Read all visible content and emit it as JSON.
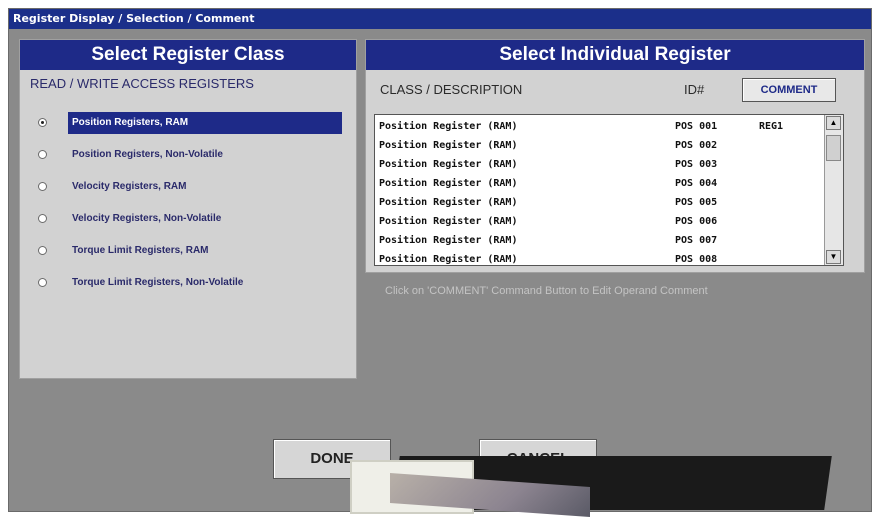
{
  "window": {
    "title": "Register Display / Selection / Comment"
  },
  "left_panel": {
    "header": "Select Register Class",
    "subtitle": "READ / WRITE ACCESS REGISTERS",
    "options": [
      {
        "label": "Position Registers, RAM",
        "checked": true
      },
      {
        "label": "Position Registers, Non-Volatile",
        "checked": false
      },
      {
        "label": "Velocity Registers, RAM",
        "checked": false
      },
      {
        "label": "Velocity Registers, Non-Volatile",
        "checked": false
      },
      {
        "label": "Torque Limit Registers, RAM",
        "checked": false
      },
      {
        "label": "Torque Limit Registers, Non-Volatile",
        "checked": false
      }
    ]
  },
  "right_panel": {
    "header": "Select Individual Register",
    "col_class": "CLASS / DESCRIPTION",
    "col_id": "ID#",
    "comment_button": "COMMENT",
    "rows": [
      {
        "description": "Position Register (RAM)",
        "id": "POS 001",
        "comment": "REG1"
      },
      {
        "description": "Position Register (RAM)",
        "id": "POS 002",
        "comment": ""
      },
      {
        "description": "Position Register (RAM)",
        "id": "POS 003",
        "comment": ""
      },
      {
        "description": "Position Register (RAM)",
        "id": "POS 004",
        "comment": ""
      },
      {
        "description": "Position Register (RAM)",
        "id": "POS 005",
        "comment": ""
      },
      {
        "description": "Position Register (RAM)",
        "id": "POS 006",
        "comment": ""
      },
      {
        "description": "Position Register (RAM)",
        "id": "POS 007",
        "comment": ""
      },
      {
        "description": "Position Register (RAM)",
        "id": "POS 008",
        "comment": ""
      }
    ],
    "scroll_up": "▲",
    "scroll_down": "▼"
  },
  "hint": "Click on 'COMMENT' Command Button to Edit Operand Comment",
  "buttons": {
    "done": "DONE",
    "cancel": "CANCEL"
  },
  "colors": {
    "title_bar": "#1b2f8a",
    "panel_header": "#1e2a88",
    "background": "#8a8a8a",
    "panel": "#d2d2d2"
  }
}
